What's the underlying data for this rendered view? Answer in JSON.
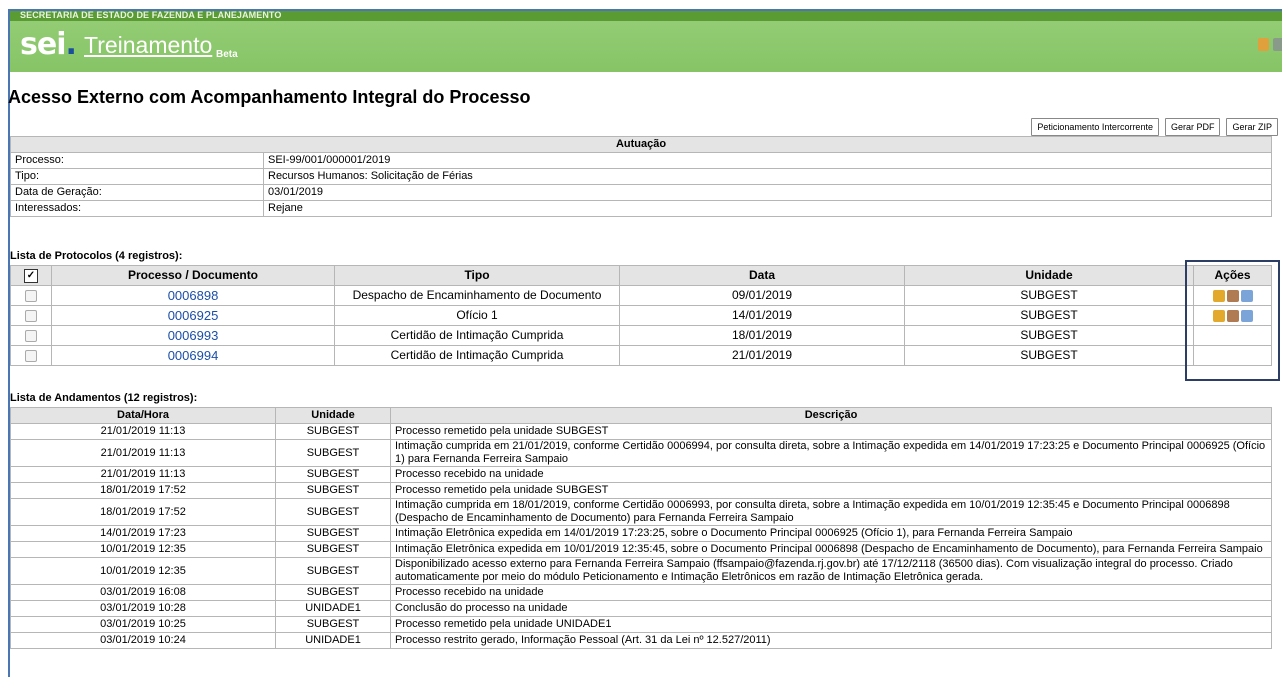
{
  "header": {
    "org": "SECRETARIA DE ESTADO DE FAZENDA E PLANEJAMENTO",
    "logo": "sei",
    "logo_dot": ".",
    "app_name": "Treinamento",
    "beta": "Beta",
    "icons": [
      "user-icon",
      "exit-icon"
    ]
  },
  "page": {
    "title": "Acesso Externo com Acompanhamento Integral do Processo"
  },
  "toolbar": {
    "peticionamento": "Peticionamento Intercorrente",
    "gerar_pdf": "Gerar PDF",
    "gerar_zip": "Gerar ZIP"
  },
  "autuacao": {
    "header": "Autuação",
    "rows": [
      {
        "label": "Processo:",
        "value": "SEI-99/001/000001/2019"
      },
      {
        "label": "Tipo:",
        "value": "Recursos Humanos: Solicitação de Férias"
      },
      {
        "label": "Data de Geração:",
        "value": "03/01/2019"
      },
      {
        "label": "Interessados:",
        "value": "Rejane"
      }
    ]
  },
  "protocolos": {
    "title": "Lista de Protocolos (4 registros):",
    "check_all": "✓",
    "columns": [
      "Processo / Documento",
      "Tipo",
      "Data",
      "Unidade",
      "Ações"
    ],
    "rows": [
      {
        "doc": "0006898",
        "tipo": "Despacho de Encaminhamento de Documento",
        "data": "09/01/2019",
        "unidade": "SUBGEST",
        "acoes": true
      },
      {
        "doc": "0006925",
        "tipo": "Ofício 1",
        "data": "14/01/2019",
        "unidade": "SUBGEST",
        "acoes": true
      },
      {
        "doc": "0006993",
        "tipo": "Certidão de Intimação Cumprida",
        "data": "18/01/2019",
        "unidade": "SUBGEST",
        "acoes": false
      },
      {
        "doc": "0006994",
        "tipo": "Certidão de Intimação Cumprida",
        "data": "21/01/2019",
        "unidade": "SUBGEST",
        "acoes": false
      }
    ]
  },
  "andamentos": {
    "title": "Lista de Andamentos (12 registros):",
    "columns": [
      "Data/Hora",
      "Unidade",
      "Descrição"
    ],
    "rows": [
      {
        "data": "21/01/2019 11:13",
        "unidade": "SUBGEST",
        "desc": "Processo remetido pela unidade SUBGEST"
      },
      {
        "data": "21/01/2019 11:13",
        "unidade": "SUBGEST",
        "desc": "Intimação cumprida em 21/01/2019, conforme Certidão 0006994, por consulta direta, sobre a Intimação expedida em 14/01/2019 17:23:25 e Documento Principal 0006925 (Ofício 1) para Fernanda Ferreira Sampaio"
      },
      {
        "data": "21/01/2019 11:13",
        "unidade": "SUBGEST",
        "desc": "Processo recebido na unidade"
      },
      {
        "data": "18/01/2019 17:52",
        "unidade": "SUBGEST",
        "desc": "Processo remetido pela unidade SUBGEST"
      },
      {
        "data": "18/01/2019 17:52",
        "unidade": "SUBGEST",
        "desc": "Intimação cumprida em 18/01/2019, conforme Certidão 0006993, por consulta direta, sobre a Intimação expedida em 10/01/2019 12:35:45 e Documento Principal 0006898 (Despacho de Encaminhamento de Documento) para Fernanda Ferreira Sampaio"
      },
      {
        "data": "14/01/2019 17:23",
        "unidade": "SUBGEST",
        "desc": "Intimação Eletrônica expedida em 14/01/2019 17:23:25, sobre o Documento Principal 0006925 (Ofício 1), para Fernanda Ferreira Sampaio"
      },
      {
        "data": "10/01/2019 12:35",
        "unidade": "SUBGEST",
        "desc": "Intimação Eletrônica expedida em 10/01/2019 12:35:45, sobre o Documento Principal 0006898 (Despacho de Encaminhamento de Documento), para Fernanda Ferreira Sampaio"
      },
      {
        "data": "10/01/2019 12:35",
        "unidade": "SUBGEST",
        "desc": "Disponibilizado acesso externo para Fernanda Ferreira Sampaio (ffsampaio@fazenda.rj.gov.br) até 17/12/2118 (36500 dias). Com visualização integral do processo. Criado automaticamente por meio do módulo Peticionamento e Intimação Eletrônicos em razão de Intimação Eletrônica gerada."
      },
      {
        "data": "03/01/2019 16:08",
        "unidade": "SUBGEST",
        "desc": "Processo recebido na unidade"
      },
      {
        "data": "03/01/2019 10:28",
        "unidade": "UNIDADE1",
        "desc": "Conclusão do processo na unidade"
      },
      {
        "data": "03/01/2019 10:25",
        "unidade": "SUBGEST",
        "desc": "Processo remetido pela unidade UNIDADE1"
      },
      {
        "data": "03/01/2019 10:24",
        "unidade": "UNIDADE1",
        "desc": "Processo restrito gerado, Informação Pessoal (Art. 31 da Lei nº 12.527/2011)"
      }
    ]
  },
  "colors": {
    "header_green": "#86c466",
    "top_strip": "#5a9c33",
    "link_blue": "#1a4fa8",
    "highlight_border": "#2c3e66"
  }
}
